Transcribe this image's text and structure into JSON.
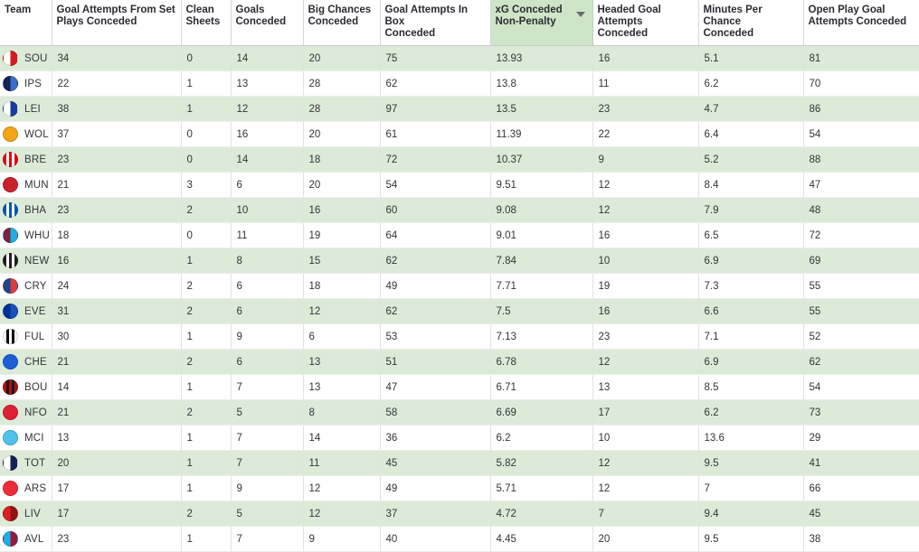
{
  "table": {
    "sorted_column_index": 6,
    "sort_direction": "descending",
    "sort_icon": "chevron-down-icon",
    "columns": [
      {
        "label": "Team",
        "lines": [
          "Team"
        ]
      },
      {
        "label": "Goal Attempts From Set Plays Conceded",
        "lines": [
          "Goal Attempts From Set",
          "Plays Conceded"
        ]
      },
      {
        "label": "Clean Sheets",
        "lines": [
          "Clean",
          "Sheets"
        ]
      },
      {
        "label": "Goals Conceded",
        "lines": [
          "Goals",
          "Conceded"
        ]
      },
      {
        "label": "Big Chances Conceded",
        "lines": [
          "Big Chances",
          "Conceded"
        ]
      },
      {
        "label": "Goal Attempts In Box Conceded",
        "lines": [
          "Goal Attempts In Box",
          "Conceded"
        ]
      },
      {
        "label": "xG Conceded Non-Penalty",
        "lines": [
          "xG Conceded",
          "Non-Penalty"
        ]
      },
      {
        "label": "Headed Goal Attempts Conceded",
        "lines": [
          "Headed Goal",
          "Attempts Conceded"
        ]
      },
      {
        "label": "Minutes Per Chance Conceded",
        "lines": [
          "Minutes Per Chance",
          "Conceded"
        ]
      },
      {
        "label": "Open Play Goal Attempts Conceded",
        "lines": [
          "Open Play Goal",
          "Attempts Conceded"
        ]
      }
    ],
    "rows": [
      {
        "team": "SOU",
        "badge": "southampton-badge",
        "badge_colors": [
          "#ffffff",
          "#d71920"
        ],
        "badge_style": "half",
        "set_plays_conceded": "34",
        "clean_sheets": "0",
        "goals_conceded": "14",
        "big_chances_conceded": "20",
        "goal_attempts_in_box_conceded": "75",
        "xg_conceded_non_penalty": "13.93",
        "headed_goal_attempts_conceded": "16",
        "minutes_per_chance_conceded": "5.1",
        "open_play_goal_attempts_conceded": "81"
      },
      {
        "team": "IPS",
        "badge": "ipswich-badge",
        "badge_colors": [
          "#132257",
          "#3a6ecb"
        ],
        "badge_style": "half",
        "set_plays_conceded": "22",
        "clean_sheets": "1",
        "goals_conceded": "13",
        "big_chances_conceded": "28",
        "goal_attempts_in_box_conceded": "62",
        "xg_conceded_non_penalty": "13.8",
        "headed_goal_attempts_conceded": "11",
        "minutes_per_chance_conceded": "6.2",
        "open_play_goal_attempts_conceded": "70"
      },
      {
        "team": "LEI",
        "badge": "leicester-badge",
        "badge_colors": [
          "#ffffff",
          "#1a3c9c"
        ],
        "badge_style": "half",
        "set_plays_conceded": "38",
        "clean_sheets": "1",
        "goals_conceded": "12",
        "big_chances_conceded": "28",
        "goal_attempts_in_box_conceded": "97",
        "xg_conceded_non_penalty": "13.5",
        "headed_goal_attempts_conceded": "23",
        "minutes_per_chance_conceded": "4.7",
        "open_play_goal_attempts_conceded": "86"
      },
      {
        "team": "WOL",
        "badge": "wolves-badge",
        "badge_colors": [
          "#f3a41a",
          "#f3a41a"
        ],
        "badge_style": "solid",
        "set_plays_conceded": "37",
        "clean_sheets": "0",
        "goals_conceded": "16",
        "big_chances_conceded": "20",
        "goal_attempts_in_box_conceded": "61",
        "xg_conceded_non_penalty": "11.39",
        "headed_goal_attempts_conceded": "22",
        "minutes_per_chance_conceded": "6.4",
        "open_play_goal_attempts_conceded": "54"
      },
      {
        "team": "BRE",
        "badge": "brentford-badge",
        "badge_colors": [
          "#e30613",
          "#ffffff"
        ],
        "badge_style": "stripes",
        "set_plays_conceded": "23",
        "clean_sheets": "0",
        "goals_conceded": "14",
        "big_chances_conceded": "18",
        "goal_attempts_in_box_conceded": "72",
        "xg_conceded_non_penalty": "10.37",
        "headed_goal_attempts_conceded": "9",
        "minutes_per_chance_conceded": "5.2",
        "open_play_goal_attempts_conceded": "88"
      },
      {
        "team": "MUN",
        "badge": "man-united-badge",
        "badge_colors": [
          "#c8232c",
          "#c8232c"
        ],
        "badge_style": "solid",
        "set_plays_conceded": "21",
        "clean_sheets": "3",
        "goals_conceded": "6",
        "big_chances_conceded": "20",
        "goal_attempts_in_box_conceded": "54",
        "xg_conceded_non_penalty": "9.51",
        "headed_goal_attempts_conceded": "12",
        "minutes_per_chance_conceded": "8.4",
        "open_play_goal_attempts_conceded": "47"
      },
      {
        "team": "BHA",
        "badge": "brighton-badge",
        "badge_colors": [
          "#0057b8",
          "#ffffff"
        ],
        "badge_style": "stripes",
        "set_plays_conceded": "23",
        "clean_sheets": "2",
        "goals_conceded": "10",
        "big_chances_conceded": "16",
        "goal_attempts_in_box_conceded": "60",
        "xg_conceded_non_penalty": "9.08",
        "headed_goal_attempts_conceded": "12",
        "minutes_per_chance_conceded": "7.9",
        "open_play_goal_attempts_conceded": "48"
      },
      {
        "team": "WHU",
        "badge": "west-ham-badge",
        "badge_colors": [
          "#7a263a",
          "#1bb1e7"
        ],
        "badge_style": "half",
        "set_plays_conceded": "18",
        "clean_sheets": "0",
        "goals_conceded": "11",
        "big_chances_conceded": "19",
        "goal_attempts_in_box_conceded": "64",
        "xg_conceded_non_penalty": "9.01",
        "headed_goal_attempts_conceded": "16",
        "minutes_per_chance_conceded": "6.5",
        "open_play_goal_attempts_conceded": "72"
      },
      {
        "team": "NEW",
        "badge": "newcastle-badge",
        "badge_colors": [
          "#241f20",
          "#ffffff"
        ],
        "badge_style": "stripes",
        "set_plays_conceded": "16",
        "clean_sheets": "1",
        "goals_conceded": "8",
        "big_chances_conceded": "15",
        "goal_attempts_in_box_conceded": "62",
        "xg_conceded_non_penalty": "7.84",
        "headed_goal_attempts_conceded": "10",
        "minutes_per_chance_conceded": "6.9",
        "open_play_goal_attempts_conceded": "69"
      },
      {
        "team": "CRY",
        "badge": "crystal-palace-badge",
        "badge_colors": [
          "#1b458f",
          "#e03a3e"
        ],
        "badge_style": "half",
        "set_plays_conceded": "24",
        "clean_sheets": "2",
        "goals_conceded": "6",
        "big_chances_conceded": "18",
        "goal_attempts_in_box_conceded": "49",
        "xg_conceded_non_penalty": "7.71",
        "headed_goal_attempts_conceded": "19",
        "minutes_per_chance_conceded": "7.3",
        "open_play_goal_attempts_conceded": "55"
      },
      {
        "team": "EVE",
        "badge": "everton-badge",
        "badge_colors": [
          "#003399",
          "#1a52bb"
        ],
        "badge_style": "half",
        "set_plays_conceded": "31",
        "clean_sheets": "2",
        "goals_conceded": "6",
        "big_chances_conceded": "12",
        "goal_attempts_in_box_conceded": "62",
        "xg_conceded_non_penalty": "7.5",
        "headed_goal_attempts_conceded": "16",
        "minutes_per_chance_conceded": "6.6",
        "open_play_goal_attempts_conceded": "55"
      },
      {
        "team": "FUL",
        "badge": "fulham-badge",
        "badge_colors": [
          "#ffffff",
          "#000000"
        ],
        "badge_style": "stripes",
        "set_plays_conceded": "30",
        "clean_sheets": "1",
        "goals_conceded": "9",
        "big_chances_conceded": "6",
        "goal_attempts_in_box_conceded": "53",
        "xg_conceded_non_penalty": "7.13",
        "headed_goal_attempts_conceded": "23",
        "minutes_per_chance_conceded": "7.1",
        "open_play_goal_attempts_conceded": "52"
      },
      {
        "team": "CHE",
        "badge": "chelsea-badge",
        "badge_colors": [
          "#1d5dd6",
          "#1d5dd6"
        ],
        "badge_style": "solid",
        "set_plays_conceded": "21",
        "clean_sheets": "2",
        "goals_conceded": "6",
        "big_chances_conceded": "13",
        "goal_attempts_in_box_conceded": "51",
        "xg_conceded_non_penalty": "6.78",
        "headed_goal_attempts_conceded": "12",
        "minutes_per_chance_conceded": "6.9",
        "open_play_goal_attempts_conceded": "62"
      },
      {
        "team": "BOU",
        "badge": "bournemouth-badge",
        "badge_colors": [
          "#b50e12",
          "#1a1a1a"
        ],
        "badge_style": "stripes",
        "set_plays_conceded": "14",
        "clean_sheets": "1",
        "goals_conceded": "7",
        "big_chances_conceded": "13",
        "goal_attempts_in_box_conceded": "47",
        "xg_conceded_non_penalty": "6.71",
        "headed_goal_attempts_conceded": "13",
        "minutes_per_chance_conceded": "8.5",
        "open_play_goal_attempts_conceded": "54"
      },
      {
        "team": "NFO",
        "badge": "nottingham-forest-badge",
        "badge_colors": [
          "#dd2233",
          "#dd2233"
        ],
        "badge_style": "solid",
        "set_plays_conceded": "21",
        "clean_sheets": "2",
        "goals_conceded": "5",
        "big_chances_conceded": "8",
        "goal_attempts_in_box_conceded": "58",
        "xg_conceded_non_penalty": "6.69",
        "headed_goal_attempts_conceded": "17",
        "minutes_per_chance_conceded": "6.2",
        "open_play_goal_attempts_conceded": "73"
      },
      {
        "team": "MCI",
        "badge": "man-city-badge",
        "badge_colors": [
          "#4fc3ec",
          "#4fc3ec"
        ],
        "badge_style": "solid",
        "set_plays_conceded": "13",
        "clean_sheets": "1",
        "goals_conceded": "7",
        "big_chances_conceded": "14",
        "goal_attempts_in_box_conceded": "36",
        "xg_conceded_non_penalty": "6.2",
        "headed_goal_attempts_conceded": "10",
        "minutes_per_chance_conceded": "13.6",
        "open_play_goal_attempts_conceded": "29"
      },
      {
        "team": "TOT",
        "badge": "tottenham-badge",
        "badge_colors": [
          "#ffffff",
          "#132257"
        ],
        "badge_style": "half",
        "set_plays_conceded": "20",
        "clean_sheets": "1",
        "goals_conceded": "7",
        "big_chances_conceded": "11",
        "goal_attempts_in_box_conceded": "45",
        "xg_conceded_non_penalty": "5.82",
        "headed_goal_attempts_conceded": "12",
        "minutes_per_chance_conceded": "9.5",
        "open_play_goal_attempts_conceded": "41"
      },
      {
        "team": "ARS",
        "badge": "arsenal-badge",
        "badge_colors": [
          "#ef2b38",
          "#ef2b38"
        ],
        "badge_style": "solid",
        "set_plays_conceded": "17",
        "clean_sheets": "1",
        "goals_conceded": "9",
        "big_chances_conceded": "12",
        "goal_attempts_in_box_conceded": "49",
        "xg_conceded_non_penalty": "5.71",
        "headed_goal_attempts_conceded": "12",
        "minutes_per_chance_conceded": "7",
        "open_play_goal_attempts_conceded": "66"
      },
      {
        "team": "LIV",
        "badge": "liverpool-badge",
        "badge_colors": [
          "#e02020",
          "#8e1616"
        ],
        "badge_style": "half",
        "set_plays_conceded": "17",
        "clean_sheets": "2",
        "goals_conceded": "5",
        "big_chances_conceded": "12",
        "goal_attempts_in_box_conceded": "37",
        "xg_conceded_non_penalty": "4.72",
        "headed_goal_attempts_conceded": "7",
        "minutes_per_chance_conceded": "9.4",
        "open_play_goal_attempts_conceded": "45"
      },
      {
        "team": "AVL",
        "badge": "aston-villa-badge",
        "badge_colors": [
          "#1bb1e7",
          "#95193c"
        ],
        "badge_style": "half",
        "set_plays_conceded": "23",
        "clean_sheets": "1",
        "goals_conceded": "7",
        "big_chances_conceded": "9",
        "goal_attempts_in_box_conceded": "40",
        "xg_conceded_non_penalty": "4.45",
        "headed_goal_attempts_conceded": "20",
        "minutes_per_chance_conceded": "9.5",
        "open_play_goal_attempts_conceded": "38"
      }
    ]
  },
  "theme": {
    "row_stripe_color": "#dcebd8",
    "row_alt_color": "#ffffff",
    "sorted_header_color": "#cfe5c8",
    "text_color": "#33333a"
  }
}
